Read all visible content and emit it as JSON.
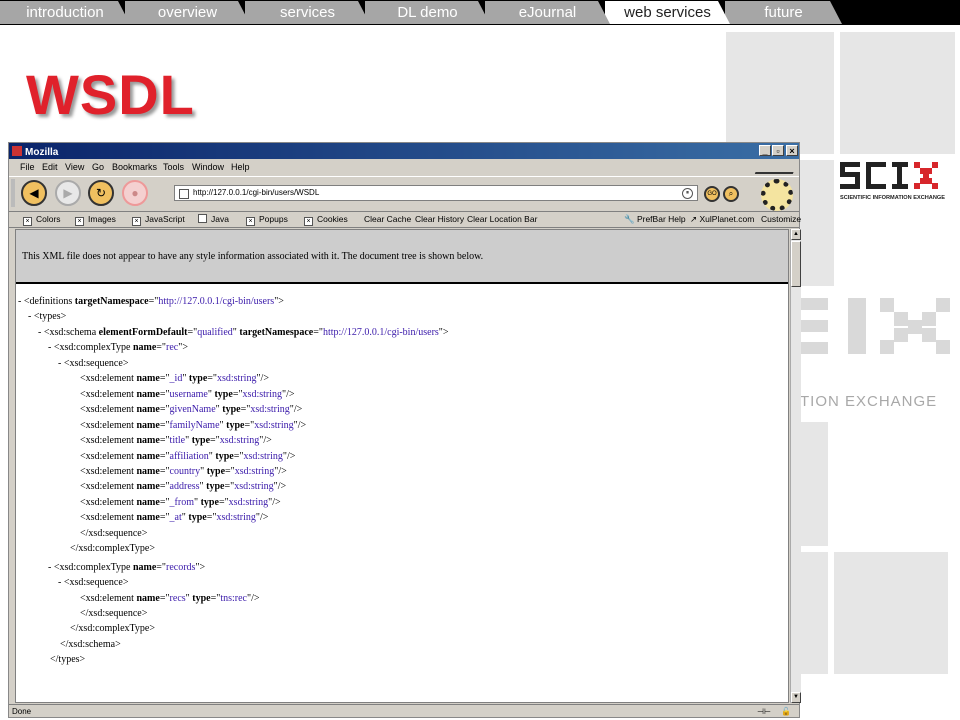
{
  "tabs": [
    {
      "label": "introduction",
      "active": false
    },
    {
      "label": "overview",
      "active": false
    },
    {
      "label": "services",
      "active": false
    },
    {
      "label": "DL demo",
      "active": false
    },
    {
      "label": "eJournal",
      "active": false
    },
    {
      "label": "web services",
      "active": true
    },
    {
      "label": "future",
      "active": false
    }
  ],
  "slide_title": "WSDL",
  "logo": {
    "mark": "SCIX",
    "tagline": "SCIENTIFIC INFORMATION EXCHANGE",
    "tagline_partial": "TION EXCHANGE"
  },
  "browser": {
    "window_title": "Mozilla",
    "window_buttons": [
      "_",
      "▫",
      "×"
    ],
    "menu": [
      "File",
      "Edit",
      "View",
      "Go",
      "Bookmarks",
      "Tools",
      "Window",
      "Help"
    ],
    "url": "http://127.0.0.1/cgi-bin/users/WSDL",
    "prefbar_checks": [
      "Colors",
      "Images",
      "JavaScript",
      "Java",
      "Popups",
      "Cookies"
    ],
    "prefbar_buttons": [
      "Clear Cache",
      "Clear History",
      "Clear Location Bar"
    ],
    "prefbar_right": [
      "PrefBar Help",
      "XulPlanet.com",
      "Customize"
    ],
    "info_message": "This XML file does not appear to have any style information associated with it. The document tree is shown below.",
    "status": "Done"
  },
  "xml_lines": [
    {
      "indent": 0,
      "minus": "- ",
      "open": "<",
      "tag": "definitions",
      "attrs": [
        {
          "n": "targetNamespace",
          "v": "http://127.0.0.1/cgi-bin/users"
        }
      ],
      "close": ">"
    },
    {
      "indent": 1,
      "minus": "- ",
      "open": "<",
      "tag": "types",
      "attrs": [],
      "close": ">"
    },
    {
      "indent": 2,
      "minus": "- ",
      "open": "<",
      "tag": "xsd:schema",
      "attrs": [
        {
          "n": "elementFormDefault",
          "v": "qualified"
        },
        {
          "n": "targetNamespace",
          "v": "http://127.0.0.1/cgi-bin/users"
        }
      ],
      "close": ">"
    },
    {
      "indent": 3,
      "minus": "- ",
      "open": "<",
      "tag": "xsd:complexType",
      "attrs": [
        {
          "n": "name",
          "v": "rec"
        }
      ],
      "close": ">"
    },
    {
      "indent": 4,
      "minus": "- ",
      "open": "<",
      "tag": "xsd:sequence",
      "attrs": [],
      "close": ">"
    },
    {
      "indent": 5,
      "minus": "",
      "open": "<",
      "tag": "xsd:element",
      "attrs": [
        {
          "n": "name",
          "v": "_id"
        },
        {
          "n": "type",
          "v": "xsd:string"
        }
      ],
      "close": "/>"
    },
    {
      "indent": 5,
      "minus": "",
      "open": "<",
      "tag": "xsd:element",
      "attrs": [
        {
          "n": "name",
          "v": "username"
        },
        {
          "n": "type",
          "v": "xsd:string"
        }
      ],
      "close": "/>"
    },
    {
      "indent": 5,
      "minus": "",
      "open": "<",
      "tag": "xsd:element",
      "attrs": [
        {
          "n": "name",
          "v": "givenName"
        },
        {
          "n": "type",
          "v": "xsd:string"
        }
      ],
      "close": "/>"
    },
    {
      "indent": 5,
      "minus": "",
      "open": "<",
      "tag": "xsd:element",
      "attrs": [
        {
          "n": "name",
          "v": "familyName"
        },
        {
          "n": "type",
          "v": "xsd:string"
        }
      ],
      "close": "/>"
    },
    {
      "indent": 5,
      "minus": "",
      "open": "<",
      "tag": "xsd:element",
      "attrs": [
        {
          "n": "name",
          "v": "title"
        },
        {
          "n": "type",
          "v": "xsd:string"
        }
      ],
      "close": "/>"
    },
    {
      "indent": 5,
      "minus": "",
      "open": "<",
      "tag": "xsd:element",
      "attrs": [
        {
          "n": "name",
          "v": "affiliation"
        },
        {
          "n": "type",
          "v": "xsd:string"
        }
      ],
      "close": "/>"
    },
    {
      "indent": 5,
      "minus": "",
      "open": "<",
      "tag": "xsd:element",
      "attrs": [
        {
          "n": "name",
          "v": "country"
        },
        {
          "n": "type",
          "v": "xsd:string"
        }
      ],
      "close": "/>"
    },
    {
      "indent": 5,
      "minus": "",
      "open": "<",
      "tag": "xsd:element",
      "attrs": [
        {
          "n": "name",
          "v": "address"
        },
        {
          "n": "type",
          "v": "xsd:string"
        }
      ],
      "close": "/>"
    },
    {
      "indent": 5,
      "minus": "",
      "open": "<",
      "tag": "xsd:element",
      "attrs": [
        {
          "n": "name",
          "v": "_from"
        },
        {
          "n": "type",
          "v": "xsd:string"
        }
      ],
      "close": "/>"
    },
    {
      "indent": 5,
      "minus": "",
      "open": "<",
      "tag": "xsd:element",
      "attrs": [
        {
          "n": "name",
          "v": "_at"
        },
        {
          "n": "type",
          "v": "xsd:string"
        }
      ],
      "close": "/>"
    },
    {
      "indent": 5,
      "minus": "",
      "open": "</",
      "tag": "xsd:sequence",
      "attrs": [],
      "close": ">"
    },
    {
      "indent": 4,
      "minus": "",
      "open": "</",
      "tag": "xsd:complexType",
      "attrs": [],
      "close": ">"
    },
    {
      "indent": 3,
      "minus": "- ",
      "open": "<",
      "tag": "xsd:complexType",
      "attrs": [
        {
          "n": "name",
          "v": "records"
        }
      ],
      "close": ">"
    },
    {
      "indent": 4,
      "minus": "- ",
      "open": "<",
      "tag": "xsd:sequence",
      "attrs": [],
      "close": ">"
    },
    {
      "indent": 5,
      "minus": "",
      "open": "<",
      "tag": "xsd:element",
      "attrs": [
        {
          "n": "name",
          "v": "recs"
        },
        {
          "n": "type",
          "v": "tns:rec"
        }
      ],
      "close": "/>"
    },
    {
      "indent": 5,
      "minus": "",
      "open": "</",
      "tag": "xsd:sequence",
      "attrs": [],
      "close": ">"
    },
    {
      "indent": 4,
      "minus": "",
      "open": "</",
      "tag": "xsd:complexType",
      "attrs": [],
      "close": ">"
    },
    {
      "indent": 3,
      "minus": "",
      "open": "</",
      "tag": "xsd:schema",
      "attrs": [],
      "close": ">"
    },
    {
      "indent": 2,
      "minus": "",
      "open": "</",
      "tag": "types",
      "attrs": [],
      "close": ">"
    }
  ],
  "colors": {
    "title_red": "#e0212b",
    "xml_value": "#3a1aaa",
    "tab_gray": "#a6a6a6"
  }
}
